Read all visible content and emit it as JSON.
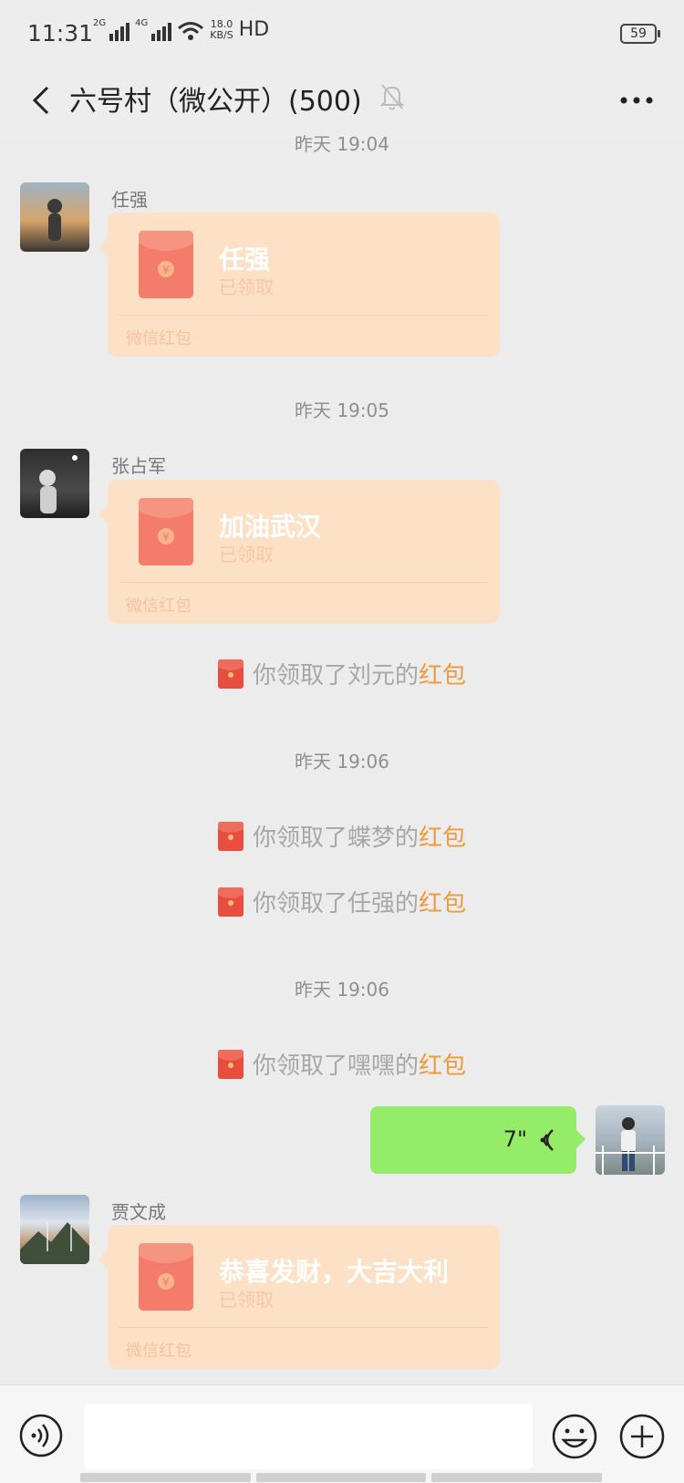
{
  "status_bar": {
    "time": "11:31",
    "sig1": "2G",
    "sig2": "4G",
    "speed_value": "18.0",
    "speed_unit": "KB/S",
    "hd": "HD",
    "battery": "59"
  },
  "header": {
    "title": "六号村（微公开）(500)"
  },
  "timestamps": [
    "昨天 19:04",
    "昨天 19:05",
    "昨天 19:06",
    "昨天 19:06"
  ],
  "messages": [
    {
      "sender": "任强",
      "greeting": "任强",
      "status": "已领取",
      "footer": "微信红包"
    },
    {
      "sender": "张占军",
      "greeting": "加油武汉",
      "status": "已领取",
      "footer": "微信红包"
    },
    {
      "sender": "贾文成",
      "greeting": "恭喜发财，大吉大利",
      "status": "已领取",
      "footer": "微信红包"
    }
  ],
  "notices": [
    {
      "prefix": "你领取了刘元的",
      "highlight": "红包"
    },
    {
      "prefix": "你领取了蝶梦的",
      "highlight": "红包"
    },
    {
      "prefix": "你领取了任强的",
      "highlight": "红包"
    },
    {
      "prefix": "你领取了嘿嘿的",
      "highlight": "红包"
    }
  ],
  "voice_message": {
    "duration": "7\""
  },
  "icons": [
    "back-arrow-icon",
    "mute-bell-icon",
    "more-icon",
    "red-envelope-icon",
    "voice-wave-icon",
    "voice-input-icon",
    "emoji-icon",
    "plus-icon"
  ],
  "colors": {
    "red_packet_bg": "#fde1c6",
    "voice_bubble": "#95ec69",
    "highlight": "#ef9a3d",
    "envelope_red": "#f47c6a"
  }
}
